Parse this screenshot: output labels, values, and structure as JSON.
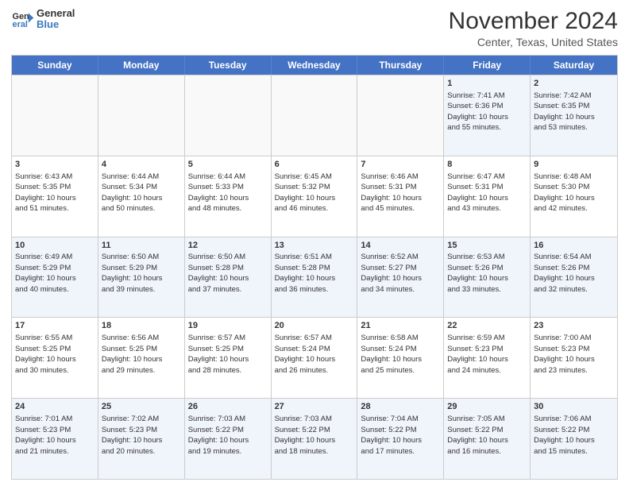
{
  "logo": {
    "line1": "General",
    "line2": "Blue"
  },
  "title": "November 2024",
  "subtitle": "Center, Texas, United States",
  "header_days": [
    "Sunday",
    "Monday",
    "Tuesday",
    "Wednesday",
    "Thursday",
    "Friday",
    "Saturday"
  ],
  "rows": [
    [
      {
        "day": "",
        "info": "",
        "empty": true
      },
      {
        "day": "",
        "info": "",
        "empty": true
      },
      {
        "day": "",
        "info": "",
        "empty": true
      },
      {
        "day": "",
        "info": "",
        "empty": true
      },
      {
        "day": "",
        "info": "",
        "empty": true
      },
      {
        "day": "1",
        "info": "Sunrise: 7:41 AM\nSunset: 6:36 PM\nDaylight: 10 hours\nand 55 minutes."
      },
      {
        "day": "2",
        "info": "Sunrise: 7:42 AM\nSunset: 6:35 PM\nDaylight: 10 hours\nand 53 minutes."
      }
    ],
    [
      {
        "day": "3",
        "info": "Sunrise: 6:43 AM\nSunset: 5:35 PM\nDaylight: 10 hours\nand 51 minutes."
      },
      {
        "day": "4",
        "info": "Sunrise: 6:44 AM\nSunset: 5:34 PM\nDaylight: 10 hours\nand 50 minutes."
      },
      {
        "day": "5",
        "info": "Sunrise: 6:44 AM\nSunset: 5:33 PM\nDaylight: 10 hours\nand 48 minutes."
      },
      {
        "day": "6",
        "info": "Sunrise: 6:45 AM\nSunset: 5:32 PM\nDaylight: 10 hours\nand 46 minutes."
      },
      {
        "day": "7",
        "info": "Sunrise: 6:46 AM\nSunset: 5:31 PM\nDaylight: 10 hours\nand 45 minutes."
      },
      {
        "day": "8",
        "info": "Sunrise: 6:47 AM\nSunset: 5:31 PM\nDaylight: 10 hours\nand 43 minutes."
      },
      {
        "day": "9",
        "info": "Sunrise: 6:48 AM\nSunset: 5:30 PM\nDaylight: 10 hours\nand 42 minutes."
      }
    ],
    [
      {
        "day": "10",
        "info": "Sunrise: 6:49 AM\nSunset: 5:29 PM\nDaylight: 10 hours\nand 40 minutes."
      },
      {
        "day": "11",
        "info": "Sunrise: 6:50 AM\nSunset: 5:29 PM\nDaylight: 10 hours\nand 39 minutes."
      },
      {
        "day": "12",
        "info": "Sunrise: 6:50 AM\nSunset: 5:28 PM\nDaylight: 10 hours\nand 37 minutes."
      },
      {
        "day": "13",
        "info": "Sunrise: 6:51 AM\nSunset: 5:28 PM\nDaylight: 10 hours\nand 36 minutes."
      },
      {
        "day": "14",
        "info": "Sunrise: 6:52 AM\nSunset: 5:27 PM\nDaylight: 10 hours\nand 34 minutes."
      },
      {
        "day": "15",
        "info": "Sunrise: 6:53 AM\nSunset: 5:26 PM\nDaylight: 10 hours\nand 33 minutes."
      },
      {
        "day": "16",
        "info": "Sunrise: 6:54 AM\nSunset: 5:26 PM\nDaylight: 10 hours\nand 32 minutes."
      }
    ],
    [
      {
        "day": "17",
        "info": "Sunrise: 6:55 AM\nSunset: 5:25 PM\nDaylight: 10 hours\nand 30 minutes."
      },
      {
        "day": "18",
        "info": "Sunrise: 6:56 AM\nSunset: 5:25 PM\nDaylight: 10 hours\nand 29 minutes."
      },
      {
        "day": "19",
        "info": "Sunrise: 6:57 AM\nSunset: 5:25 PM\nDaylight: 10 hours\nand 28 minutes."
      },
      {
        "day": "20",
        "info": "Sunrise: 6:57 AM\nSunset: 5:24 PM\nDaylight: 10 hours\nand 26 minutes."
      },
      {
        "day": "21",
        "info": "Sunrise: 6:58 AM\nSunset: 5:24 PM\nDaylight: 10 hours\nand 25 minutes."
      },
      {
        "day": "22",
        "info": "Sunrise: 6:59 AM\nSunset: 5:23 PM\nDaylight: 10 hours\nand 24 minutes."
      },
      {
        "day": "23",
        "info": "Sunrise: 7:00 AM\nSunset: 5:23 PM\nDaylight: 10 hours\nand 23 minutes."
      }
    ],
    [
      {
        "day": "24",
        "info": "Sunrise: 7:01 AM\nSunset: 5:23 PM\nDaylight: 10 hours\nand 21 minutes."
      },
      {
        "day": "25",
        "info": "Sunrise: 7:02 AM\nSunset: 5:23 PM\nDaylight: 10 hours\nand 20 minutes."
      },
      {
        "day": "26",
        "info": "Sunrise: 7:03 AM\nSunset: 5:22 PM\nDaylight: 10 hours\nand 19 minutes."
      },
      {
        "day": "27",
        "info": "Sunrise: 7:03 AM\nSunset: 5:22 PM\nDaylight: 10 hours\nand 18 minutes."
      },
      {
        "day": "28",
        "info": "Sunrise: 7:04 AM\nSunset: 5:22 PM\nDaylight: 10 hours\nand 17 minutes."
      },
      {
        "day": "29",
        "info": "Sunrise: 7:05 AM\nSunset: 5:22 PM\nDaylight: 10 hours\nand 16 minutes."
      },
      {
        "day": "30",
        "info": "Sunrise: 7:06 AM\nSunset: 5:22 PM\nDaylight: 10 hours\nand 15 minutes."
      }
    ]
  ]
}
